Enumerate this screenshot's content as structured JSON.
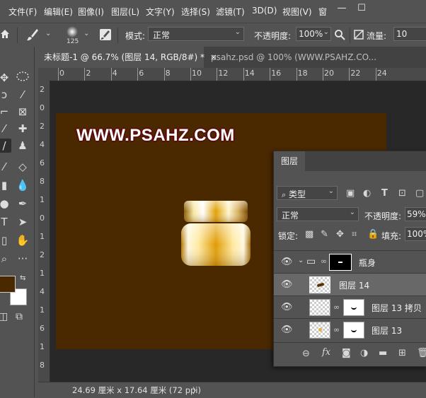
{
  "menu": [
    "文件(F)",
    "编辑(E)",
    "图像(I)",
    "图层(L)",
    "文字(Y)",
    "选择(S)",
    "滤镜(T)",
    "3D(D)",
    "视图(V)",
    "窗"
  ],
  "window_controls": [
    "—",
    "☐"
  ],
  "options_bar": {
    "brush_size": "125",
    "mode_label": "模式:",
    "mode_value": "正常",
    "opacity_label": "不透明度:",
    "opacity_value": "100%",
    "flow_label": "流量:",
    "flow_value": "10"
  },
  "tabs": [
    {
      "label": "未标题-1 @ 66.7% (图层 14, RGB/8#) *",
      "close": "×"
    },
    {
      "label": "psahz.psd @ 100% (WWW.PSAHZ.CO..."
    }
  ],
  "ruler_top": [
    "0",
    "2",
    "4",
    "6",
    "8",
    "10",
    "12",
    "14",
    "16",
    "18",
    "20",
    "22",
    "24"
  ],
  "ruler_left": [
    "2",
    "0",
    "2",
    "4",
    "6",
    "8",
    "1",
    "0",
    "1",
    "2",
    "1",
    "4",
    "1",
    "6",
    "1",
    "8"
  ],
  "canvas": {
    "watermark": "WWW.PSAHZ.COM",
    "background": "#4a2800",
    "foreground_swatch": "#4a2800",
    "background_swatch": "#ffffff"
  },
  "status_bar": "24.69 厘米 x 17.64 厘米 (72 ppi)",
  "status_arrow": "〉",
  "layers_panel": {
    "tab": "图层",
    "kind_filter": "类型",
    "blend_mode": "正常",
    "opacity_label": "不透明度:",
    "opacity_value": "59%",
    "lock_label": "锁定:",
    "fill_label": "填充:",
    "fill_value": "100%",
    "layers": [
      {
        "name": "瓶身",
        "type": "group"
      },
      {
        "name": "图层 14",
        "type": "layer",
        "selected": true
      },
      {
        "name": "图层 13 拷贝",
        "type": "masked"
      },
      {
        "name": "图层 13",
        "type": "masked"
      }
    ]
  }
}
